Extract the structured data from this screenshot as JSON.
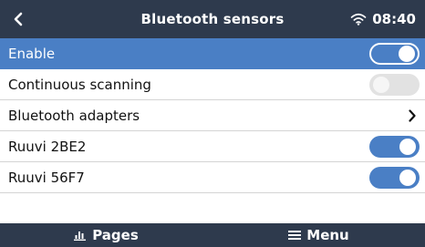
{
  "header": {
    "back_icon": "chevron-left-icon",
    "title": "Bluetooth sensors",
    "wifi_icon": "wifi-icon",
    "time": "08:40"
  },
  "rows": [
    {
      "label": "Enable",
      "control": "switch",
      "state": "on",
      "selected": true
    },
    {
      "label": "Continuous scanning",
      "control": "switch",
      "state": "off",
      "selected": false
    },
    {
      "label": "Bluetooth adapters",
      "control": "chevron-right-icon",
      "selected": false
    },
    {
      "label": "Ruuvi 2BE2",
      "control": "switch",
      "state": "on",
      "selected": false
    },
    {
      "label": "Ruuvi 56F7",
      "control": "switch",
      "state": "on",
      "selected": false
    }
  ],
  "footer": {
    "pages_label": "Pages",
    "pages_icon": "bar-chart-icon",
    "menu_label": "Menu",
    "menu_icon": "hamburger-icon"
  },
  "colors": {
    "header_bg": "#2e3a4d",
    "accent": "#4a7fc5",
    "switch_off": "#e2e2e2"
  }
}
